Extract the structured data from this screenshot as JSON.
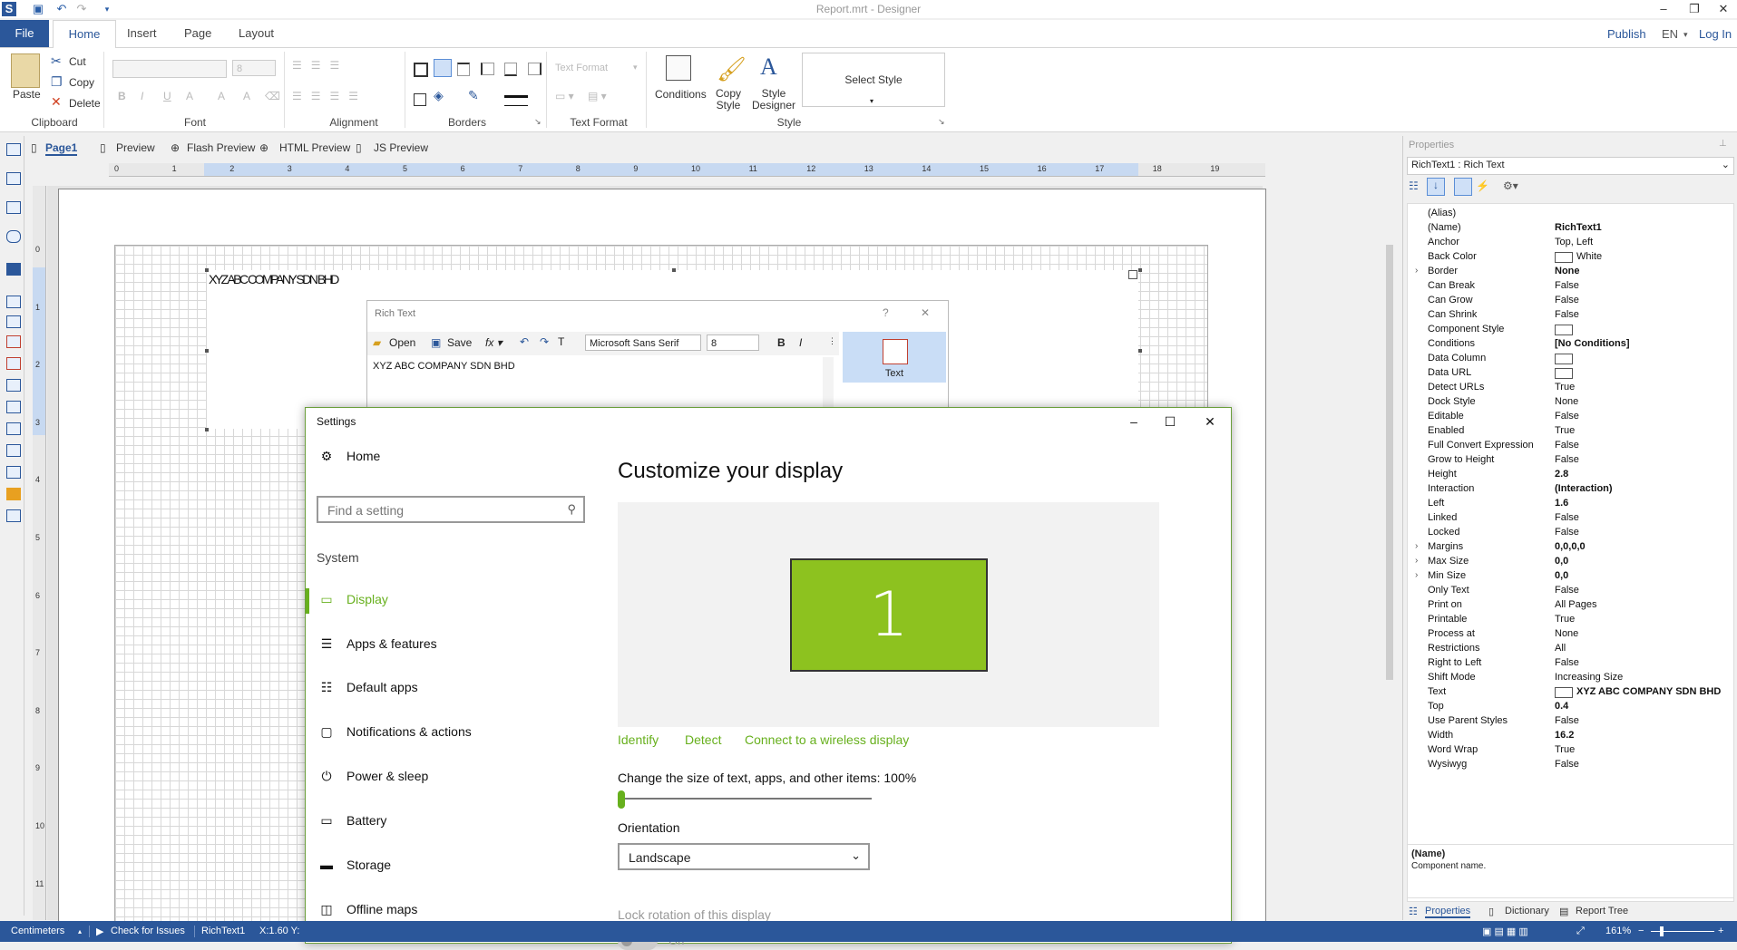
{
  "window": {
    "title": "Report.mrt - Designer"
  },
  "menu": {
    "file": "File",
    "tabs": [
      "Home",
      "Insert",
      "Page",
      "Layout"
    ],
    "right": {
      "publish": "Publish",
      "lang": "EN",
      "login": "Log In"
    }
  },
  "ribbon": {
    "clipboard": {
      "label": "Clipboard",
      "paste": "Paste",
      "cut": "Cut",
      "copy": "Copy",
      "delete": "Delete"
    },
    "font": {
      "label": "Font",
      "size": "8"
    },
    "alignment": {
      "label": "Alignment"
    },
    "borders": {
      "label": "Borders"
    },
    "text_format": {
      "label": "Text Format",
      "combo": "Text Format"
    },
    "style": {
      "label": "Style",
      "conditions": "Conditions",
      "copy_style": "Copy Style",
      "style_designer": "Style Designer",
      "select_style": "Select Style"
    }
  },
  "doctabs": [
    "Page1",
    "Preview",
    "Flash Preview",
    "HTML Preview",
    "JS Preview"
  ],
  "ruler": {
    "h": [
      "0",
      "1",
      "2",
      "3",
      "4",
      "5",
      "6",
      "7",
      "8",
      "9",
      "10",
      "11",
      "12",
      "13",
      "14",
      "15",
      "16",
      "17",
      "18",
      "19"
    ],
    "v": [
      "0",
      "1",
      "2",
      "3",
      "4",
      "5",
      "6",
      "7",
      "8",
      "9",
      "10",
      "11"
    ]
  },
  "report": {
    "richtext_content": "XYZ ABC COMPANY SDN BHD"
  },
  "richtext_dialog": {
    "title": "Rich Text",
    "open": "Open",
    "save": "Save",
    "font": "Microsoft Sans Serif",
    "size": "8",
    "content": "XYZ ABC COMPANY SDN BHD",
    "side_button": "Text"
  },
  "settings": {
    "title": "Settings",
    "home": "Home",
    "search_placeholder": "Find a setting",
    "section": "System",
    "nav": [
      {
        "label": "Display",
        "icon": "monitor-icon"
      },
      {
        "label": "Apps & features",
        "icon": "list-icon"
      },
      {
        "label": "Default apps",
        "icon": "default-apps-icon"
      },
      {
        "label": "Notifications & actions",
        "icon": "chat-icon"
      },
      {
        "label": "Power & sleep",
        "icon": "power-icon"
      },
      {
        "label": "Battery",
        "icon": "battery-icon"
      },
      {
        "label": "Storage",
        "icon": "storage-icon"
      },
      {
        "label": "Offline maps",
        "icon": "map-icon"
      }
    ],
    "heading": "Customize your display",
    "monitor_number": "1",
    "links": [
      "Identify",
      "Detect",
      "Connect to a wireless display"
    ],
    "scale_label": "Change the size of text, apps, and other items: 100%",
    "scale_value": 0.0,
    "orientation_label": "Orientation",
    "orientation_value": "Landscape",
    "lock_label": "Lock rotation of this display",
    "lock_state": "On",
    "accent": "#67b01d"
  },
  "properties": {
    "header": "Properties",
    "selector": "RichText1 : Rich Text",
    "rows": [
      {
        "name": "(Alias)",
        "value": "",
        "bold": false,
        "expand": false
      },
      {
        "name": "(Name)",
        "value": "RichText1",
        "bold": true,
        "expand": false
      },
      {
        "name": "Anchor",
        "value": "Top, Left",
        "bold": false,
        "expand": false
      },
      {
        "name": "Back Color",
        "value": "White",
        "bold": false,
        "expand": false
      },
      {
        "name": "Border",
        "value": "None",
        "bold": true,
        "expand": true
      },
      {
        "name": "Can Break",
        "value": "False",
        "bold": false,
        "expand": false
      },
      {
        "name": "Can Grow",
        "value": "False",
        "bold": false,
        "expand": false
      },
      {
        "name": "Can Shrink",
        "value": "False",
        "bold": false,
        "expand": false
      },
      {
        "name": "Component Style",
        "value": "",
        "bold": false,
        "expand": false
      },
      {
        "name": "Conditions",
        "value": "[No Conditions]",
        "bold": true,
        "expand": false
      },
      {
        "name": "Data Column",
        "value": "",
        "bold": false,
        "expand": false
      },
      {
        "name": "Data URL",
        "value": "",
        "bold": false,
        "expand": false
      },
      {
        "name": "Detect URLs",
        "value": "True",
        "bold": false,
        "expand": false
      },
      {
        "name": "Dock Style",
        "value": "None",
        "bold": false,
        "expand": false
      },
      {
        "name": "Editable",
        "value": "False",
        "bold": false,
        "expand": false
      },
      {
        "name": "Enabled",
        "value": "True",
        "bold": false,
        "expand": false
      },
      {
        "name": "Full Convert Expression",
        "value": "False",
        "bold": false,
        "expand": false
      },
      {
        "name": "Grow to Height",
        "value": "False",
        "bold": false,
        "expand": false
      },
      {
        "name": "Height",
        "value": "2.8",
        "bold": true,
        "expand": false
      },
      {
        "name": "Interaction",
        "value": "(Interaction)",
        "bold": true,
        "expand": false
      },
      {
        "name": "Left",
        "value": "1.6",
        "bold": true,
        "expand": false
      },
      {
        "name": "Linked",
        "value": "False",
        "bold": false,
        "expand": false
      },
      {
        "name": "Locked",
        "value": "False",
        "bold": false,
        "expand": false
      },
      {
        "name": "Margins",
        "value": "0,0,0,0",
        "bold": true,
        "expand": true
      },
      {
        "name": "Max Size",
        "value": "0,0",
        "bold": true,
        "expand": true
      },
      {
        "name": "Min Size",
        "value": "0,0",
        "bold": true,
        "expand": true
      },
      {
        "name": "Only Text",
        "value": "False",
        "bold": false,
        "expand": false
      },
      {
        "name": "Print on",
        "value": "All Pages",
        "bold": false,
        "expand": false
      },
      {
        "name": "Printable",
        "value": "True",
        "bold": false,
        "expand": false
      },
      {
        "name": "Process at",
        "value": "None",
        "bold": false,
        "expand": false
      },
      {
        "name": "Restrictions",
        "value": "All",
        "bold": false,
        "expand": false
      },
      {
        "name": "Right to Left",
        "value": "False",
        "bold": false,
        "expand": false
      },
      {
        "name": "Shift Mode",
        "value": "Increasing Size",
        "bold": false,
        "expand": false
      },
      {
        "name": "Text",
        "value": "XYZ ABC COMPANY SDN BHD",
        "bold": true,
        "expand": false
      },
      {
        "name": "Top",
        "value": "0.4",
        "bold": true,
        "expand": false
      },
      {
        "name": "Use Parent Styles",
        "value": "False",
        "bold": false,
        "expand": false
      },
      {
        "name": "Width",
        "value": "16.2",
        "bold": true,
        "expand": false
      },
      {
        "name": "Word Wrap",
        "value": "True",
        "bold": false,
        "expand": false
      },
      {
        "name": "Wysiwyg",
        "value": "False",
        "bold": false,
        "expand": false
      }
    ],
    "desc_title": "(Name)",
    "desc_text": "Component name.",
    "bottom_tabs": [
      "Properties",
      "Dictionary",
      "Report Tree"
    ]
  },
  "status": {
    "units": "Centimeters",
    "check": "Check for Issues",
    "component": "RichText1",
    "coords": "X:1.60  Y:",
    "zoom": "161%"
  }
}
